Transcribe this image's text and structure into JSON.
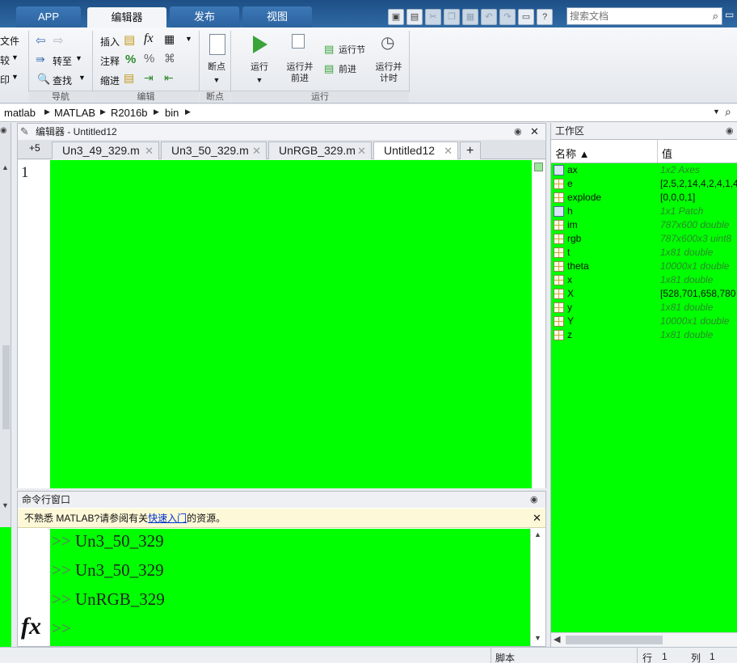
{
  "tabs": [
    "APP",
    "编辑器",
    "发布",
    "视图"
  ],
  "search": {
    "placeholder": "搜索文档"
  },
  "ribbon": {
    "file": {
      "new": "新建文件",
      "compare": "比较",
      "print": "打印"
    },
    "nav": {
      "goto": "转至",
      "find": "查找",
      "group": "导航"
    },
    "edit": {
      "insert": "插入",
      "comment": "注释",
      "indent": "缩进",
      "group": "编辑",
      "fx": "fx",
      "percent": "%"
    },
    "breakpoints": {
      "label": "断点",
      "group": "断点"
    },
    "run": {
      "run": "运行",
      "run_advance_1": "运行并",
      "run_advance_2": "前进",
      "run_section": "运行节",
      "advance": "前进",
      "run_time_1": "运行并",
      "run_time_2": "计时",
      "group": "运行"
    }
  },
  "path": [
    "matlab",
    "MATLAB",
    "R2016b",
    "bin"
  ],
  "editor": {
    "title": "编辑器 - Untitled12",
    "plus": "+5",
    "tabs": [
      "Un3_49_329.m",
      "Un3_50_329.m",
      "UnRGB_329.m",
      "Untitled12"
    ],
    "add_tab": "+",
    "line_number": "1"
  },
  "command_window": {
    "title": "命令行窗口",
    "notice_before": "不熟悉 MATLAB?请参阅有关",
    "notice_link": "快速入门",
    "notice_after": "的资源。",
    "prompt": ">>",
    "lines": [
      "Un3_50_329",
      "Un3_50_329",
      "UnRGB_329"
    ],
    "fx": "fx"
  },
  "workspace": {
    "title": "工作区",
    "col_name": "名称 ▲",
    "col_value": "值",
    "vars": [
      {
        "name": "ax",
        "value": "1x2 Axes",
        "kind": "obj"
      },
      {
        "name": "e",
        "value": "[2,5,2,14,4,2,4,1,4",
        "kind": "grid"
      },
      {
        "name": "explode",
        "value": "[0,0,0,1]",
        "kind": "grid"
      },
      {
        "name": "h",
        "value": "1x1 Patch",
        "kind": "obj"
      },
      {
        "name": "im",
        "value": "787x600 double",
        "kind": "grid"
      },
      {
        "name": "rgb",
        "value": "787x600x3 uint8",
        "kind": "grid"
      },
      {
        "name": "t",
        "value": "1x81 double",
        "kind": "grid"
      },
      {
        "name": "theta",
        "value": "10000x1 double",
        "kind": "grid"
      },
      {
        "name": "x",
        "value": "1x81 double",
        "kind": "grid"
      },
      {
        "name": "X",
        "value": "[528,701,658,780",
        "kind": "grid"
      },
      {
        "name": "y",
        "value": "1x81 double",
        "kind": "grid"
      },
      {
        "name": "Y",
        "value": "10000x1 double",
        "kind": "grid"
      },
      {
        "name": "z",
        "value": "1x81 double",
        "kind": "grid"
      }
    ]
  },
  "status": {
    "mode": "脚本",
    "row_label": "行",
    "row": "1",
    "col_label": "列",
    "col": "1"
  }
}
